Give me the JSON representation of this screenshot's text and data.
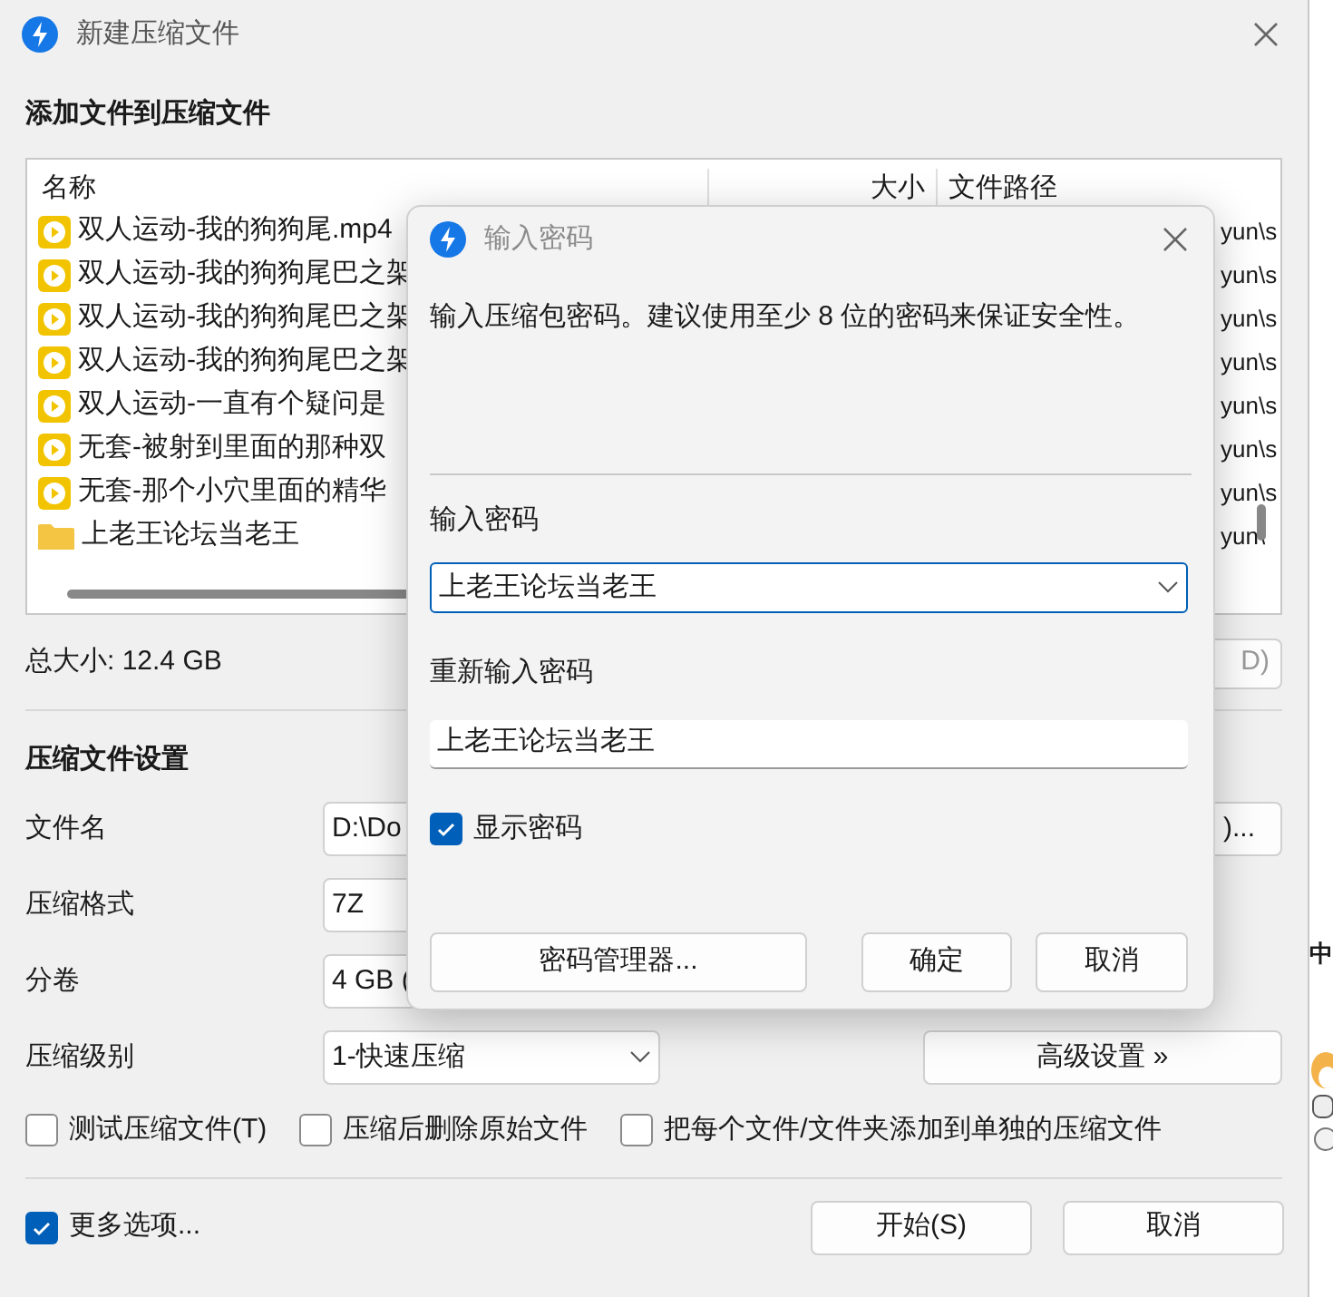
{
  "window": {
    "title": "新建压缩文件"
  },
  "add_section": {
    "title": "添加文件到压缩文件"
  },
  "file_list": {
    "columns": [
      "名称",
      "大小",
      "文件路径"
    ],
    "rows": [
      {
        "kind": "video",
        "name": "双人运动-我的狗狗尾.mp4",
        "path": "yun\\s"
      },
      {
        "kind": "video",
        "name": "双人运动-我的狗狗尾巴之架",
        "path": "yun\\s"
      },
      {
        "kind": "video",
        "name": "双人运动-我的狗狗尾巴之架",
        "path": "yun\\s"
      },
      {
        "kind": "video",
        "name": "双人运动-我的狗狗尾巴之架",
        "path": "yun\\s"
      },
      {
        "kind": "video",
        "name": "双人运动-一直有个疑问是",
        "path": "yun\\s"
      },
      {
        "kind": "video",
        "name": "无套-被射到里面的那种双",
        "path": "yun\\s"
      },
      {
        "kind": "video",
        "name": "无套-那个小穴里面的精华",
        "path": "yun\\s"
      },
      {
        "kind": "folder",
        "name": "上老王论坛当老王",
        "path": "yun\\"
      }
    ]
  },
  "total_size": "总大小: 12.4 GB",
  "partial_button": "D)",
  "settings": {
    "title": "压缩文件设置",
    "fields": [
      {
        "kind": "text",
        "label": "文件名",
        "value": "D:\\Do",
        "button": ")..."
      },
      {
        "kind": "text",
        "label": "压缩格式",
        "value": "7Z"
      },
      {
        "kind": "text",
        "label": "分卷",
        "value": "4 GB ("
      },
      {
        "kind": "dropdown",
        "label": "压缩级别",
        "value": "1-快速压缩",
        "button": "高级设置 »"
      }
    ]
  },
  "options": [
    {
      "label": "测试压缩文件(T)",
      "checked": false
    },
    {
      "label": "压缩后删除原始文件",
      "checked": false
    },
    {
      "label": "把每个文件/文件夹添加到单独的压缩文件",
      "checked": false
    }
  ],
  "more_options": {
    "label": "更多选项...",
    "checked": true
  },
  "buttons": [
    "开始(S)",
    "取消"
  ],
  "dialog": {
    "title": "输入密码",
    "message": "输入压缩包密码。建议使用至少 8 位的密码来保证安全性。",
    "password_label": "输入密码",
    "password_value": "上老王论坛当老王",
    "repeat_label": "重新输入密码",
    "repeat_value": "上老王论坛当老王",
    "show_password": {
      "label": "显示密码",
      "checked": true
    },
    "buttons": [
      "密码管理器...",
      "确定",
      "取消"
    ]
  },
  "ime_indicator": "中"
}
